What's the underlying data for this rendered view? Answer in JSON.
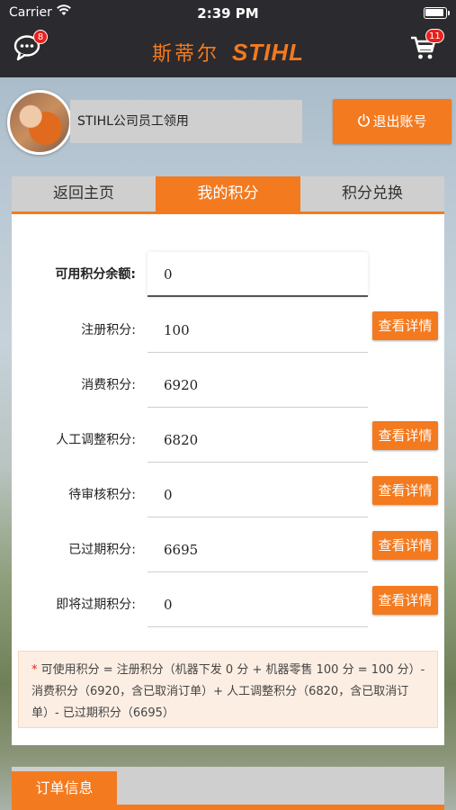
{
  "status_bar": {
    "carrier": "Carrier",
    "time": "2:39 PM"
  },
  "navbar": {
    "brand_cn": "斯蒂尔",
    "brand_logo": "STIHL",
    "message_badge": "8",
    "cart_badge": "11",
    "message_icon": "chat-bubble-icon",
    "cart_icon": "shopping-cart-icon"
  },
  "user": {
    "name": "STIHL公司员工领用",
    "logout_label": "退出账号",
    "logout_icon": "power-icon"
  },
  "tabs": [
    {
      "label": "返回主页"
    },
    {
      "label": "我的积分",
      "active": true
    },
    {
      "label": "积分兑换"
    }
  ],
  "points": [
    {
      "label": "可用积分余额:",
      "value": "0"
    },
    {
      "label": "注册积分:",
      "value": "100",
      "button": "查看详情"
    },
    {
      "label": "消费积分:",
      "value": "6920"
    },
    {
      "label": "人工调整积分:",
      "value": "6820",
      "button": "查看详情"
    },
    {
      "label": "待审核积分:",
      "value": "0",
      "button": "查看详情"
    },
    {
      "label": "已过期积分:",
      "value": "6695",
      "button": "查看详情"
    },
    {
      "label": "即将过期积分:",
      "value": "0",
      "button": "查看详情"
    }
  ],
  "note": {
    "star": "*",
    "text": "可使用积分 = 注册积分（机器下发 0 分 + 机器零售 100 分 = 100 分）- 消费积分（6920，含已取消订单）+ 人工调整积分（6820，含已取消订单）- 已过期积分（6695）"
  },
  "order": {
    "tab_label": "订单信息"
  },
  "colors": {
    "accent": "#f37a1f",
    "dark": "#2b2a2e",
    "badge": "#e8211f"
  }
}
